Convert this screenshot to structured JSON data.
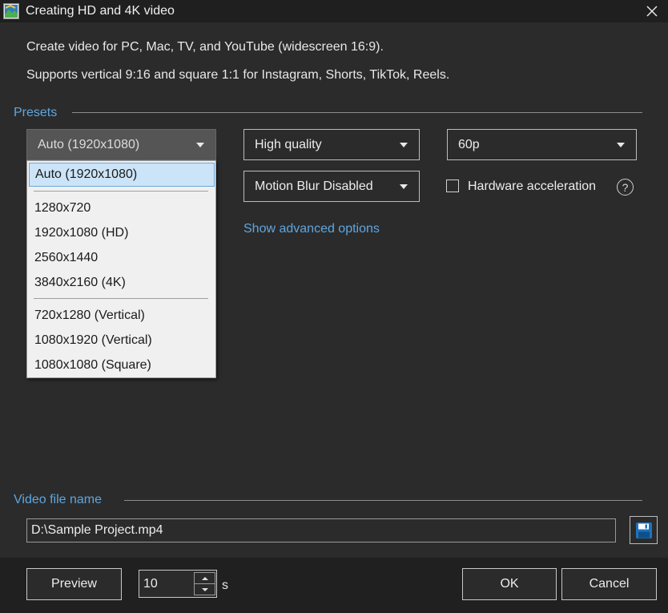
{
  "window": {
    "title": "Creating HD and 4K video"
  },
  "description": {
    "line1": "Create video for PC, Mac, TV, and YouTube (widescreen 16:9).",
    "line2": "Supports vertical 9:16 and square 1:1 for Instagram, Shorts, TikTok, Reels."
  },
  "presets": {
    "section_label": "Presets",
    "resolution_selected": "Auto (1920x1080)",
    "resolution_options": [
      "Auto (1920x1080)",
      "1280x720",
      "1920x1080 (HD)",
      "2560x1440",
      "3840x2160 (4K)",
      "720x1280 (Vertical)",
      "1080x1920 (Vertical)",
      "1080x1080 (Square)"
    ],
    "quality_selected": "High quality",
    "framerate_selected": "60p",
    "motion_blur_selected": "Motion Blur Disabled",
    "hardware_acceleration_label": "Hardware acceleration",
    "hardware_acceleration_checked": false,
    "help_label": "?",
    "advanced_link": "Show advanced options"
  },
  "file": {
    "section_label": "Video file name",
    "value": "D:\\Sample Project.mp4"
  },
  "footer": {
    "preview_label": "Preview",
    "duration_value": "10",
    "duration_unit": "s",
    "ok_label": "OK",
    "cancel_label": "Cancel"
  },
  "colors": {
    "background": "#2b2b2b",
    "titlebar": "#1f1f1f",
    "footer": "#202020",
    "accent": "#5ea6e0",
    "selection": "#cce4f7"
  }
}
